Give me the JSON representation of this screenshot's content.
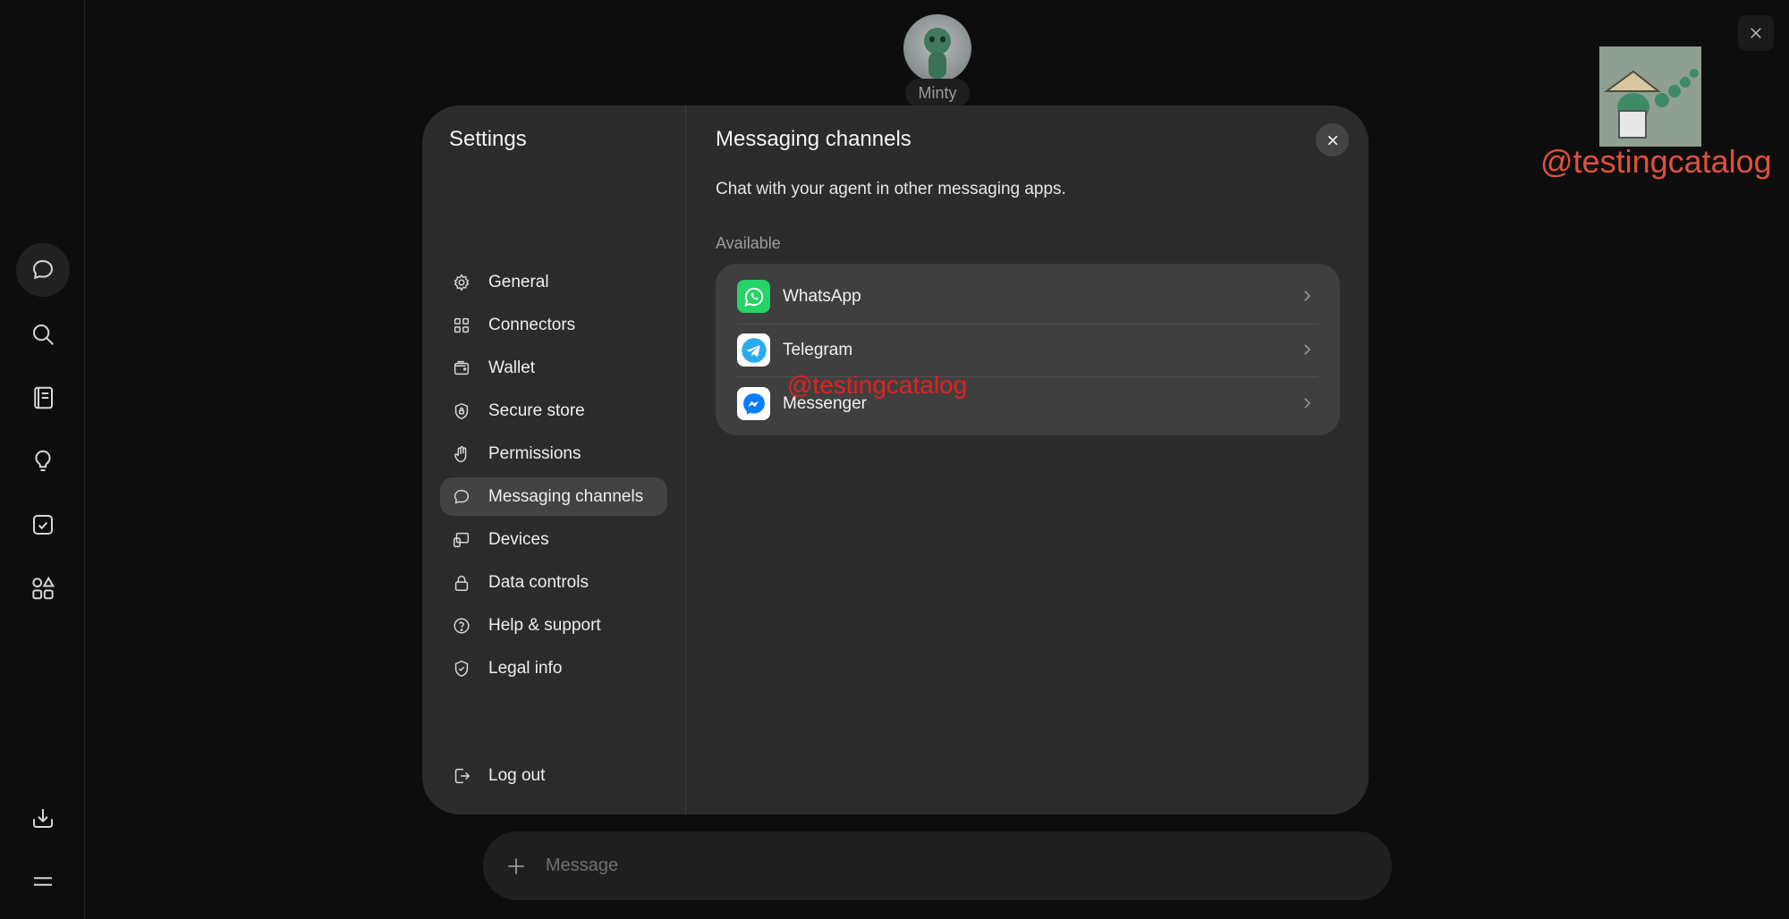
{
  "rail": {
    "items": [
      {
        "icon": "chat-bubble-icon",
        "active": true
      },
      {
        "icon": "search-icon"
      },
      {
        "icon": "notebook-icon"
      },
      {
        "icon": "lightbulb-icon"
      },
      {
        "icon": "checkbox-icon"
      },
      {
        "icon": "shapes-icon"
      },
      {
        "icon": "download-icon"
      },
      {
        "icon": "menu-icon"
      }
    ]
  },
  "agent": {
    "name": "Minty"
  },
  "watermark": {
    "handle": "@testingcatalog"
  },
  "settings": {
    "title": "Settings",
    "nav": [
      {
        "label": "General",
        "icon": "gear-icon"
      },
      {
        "label": "Connectors",
        "icon": "grid-icon"
      },
      {
        "label": "Wallet",
        "icon": "wallet-icon"
      },
      {
        "label": "Secure store",
        "icon": "shield-lock-icon"
      },
      {
        "label": "Permissions",
        "icon": "hand-icon"
      },
      {
        "label": "Messaging channels",
        "icon": "chat-bubble-icon",
        "active": true
      },
      {
        "label": "Devices",
        "icon": "devices-icon"
      },
      {
        "label": "Data controls",
        "icon": "lock-icon"
      },
      {
        "label": "Help & support",
        "icon": "question-icon"
      },
      {
        "label": "Legal info",
        "icon": "shield-check-icon"
      }
    ],
    "logout_label": "Log out"
  },
  "panel": {
    "title": "Messaging channels",
    "subtitle": "Chat with your agent in other messaging apps.",
    "section_label": "Available",
    "channels": [
      {
        "name": "WhatsApp",
        "icon": "whatsapp-icon",
        "color": "#25D366"
      },
      {
        "name": "Telegram",
        "icon": "telegram-icon",
        "color": "#2AABEE"
      },
      {
        "name": "Messenger",
        "icon": "messenger-icon",
        "color": "#0A7CFF"
      }
    ]
  },
  "composer": {
    "placeholder": "Message"
  }
}
